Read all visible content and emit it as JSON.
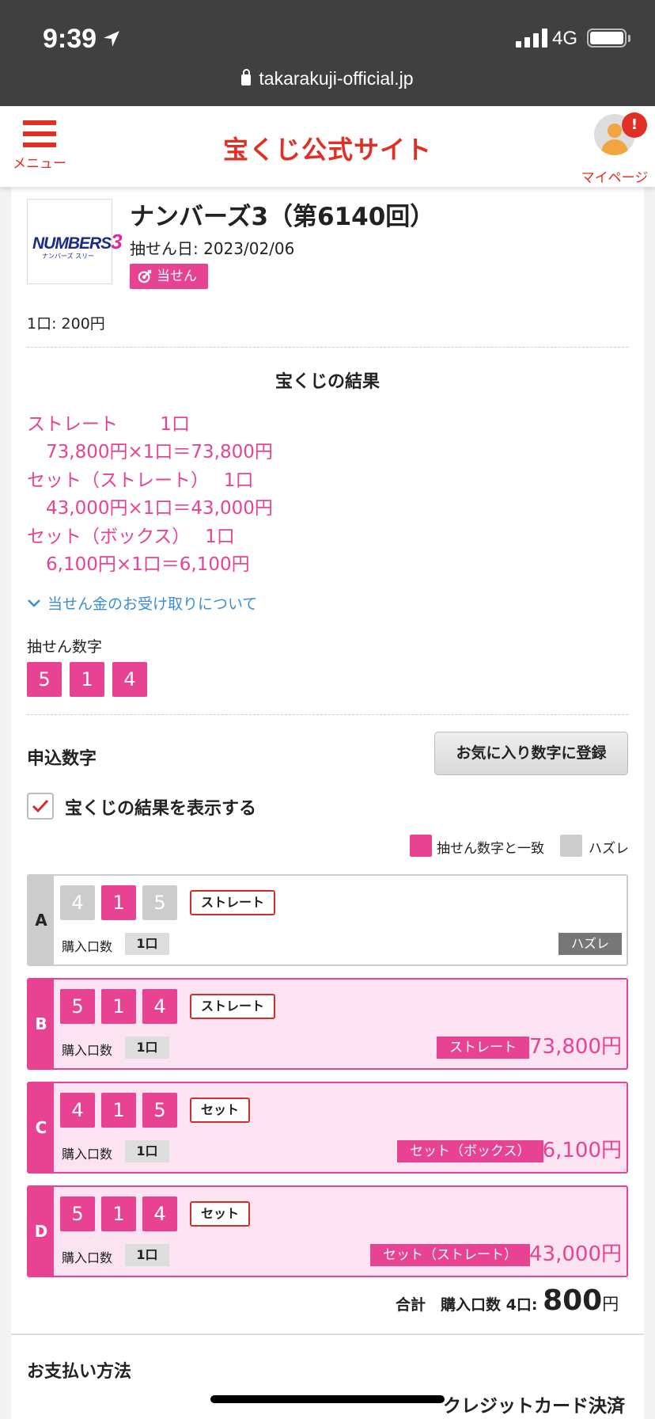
{
  "status_bar": {
    "time": "9:39",
    "network": "4G",
    "url": "takarakuji-official.jp"
  },
  "header": {
    "menu_label": "メニュー",
    "logo_text": "宝くじ公式サイト",
    "mypage_label": "マイページ",
    "alert_badge": "!"
  },
  "ticket": {
    "logo_text": "NUMBERS",
    "logo_number": "3",
    "logo_sub": "ナンバーズ スリー",
    "title": "ナンバーズ3（第6140回）",
    "draw_date": "抽せん日: 2023/02/06",
    "status_badge": "当せん",
    "unit_price": "1口: 200円"
  },
  "results": {
    "title": "宝くじの結果",
    "prizes": [
      {
        "line": "ストレート　　 1口",
        "calc": "73,800円×1口＝73,800円"
      },
      {
        "line": "セット（ストレート）　 1口",
        "calc": "43,000円×1口＝43,000円"
      },
      {
        "line": "セット（ボックス）　 1口",
        "calc": "6,100円×1口＝6,100円"
      }
    ],
    "receipt_link": "当せん金のお受け取りについて",
    "draw_numbers_label": "抽せん数字",
    "draw_numbers": [
      "5",
      "1",
      "4"
    ]
  },
  "application": {
    "label": "申込数字",
    "favorite_button": "お気に入り数字に登録",
    "show_results_label": "宝くじの結果を表示する",
    "show_results_checked": true,
    "legend_match": "抽せん数字と一致",
    "legend_miss": "ハズレ",
    "colors": {
      "match": "#e84393",
      "miss": "#cccccc"
    },
    "qty_label": "購入口数",
    "rows": [
      {
        "letter": "A",
        "numbers": [
          "4",
          "1",
          "5"
        ],
        "hits": [
          false,
          true,
          false
        ],
        "type": "ストレート",
        "qty": "1口",
        "result": "ハズレ",
        "amount": ""
      },
      {
        "letter": "B",
        "numbers": [
          "5",
          "1",
          "4"
        ],
        "hits": [
          true,
          true,
          true
        ],
        "type": "ストレート",
        "qty": "1口",
        "result": "ストレート",
        "amount": "73,800円"
      },
      {
        "letter": "C",
        "numbers": [
          "4",
          "1",
          "5"
        ],
        "hits": [
          true,
          true,
          true
        ],
        "type": "セット",
        "qty": "1口",
        "result": "セット（ボックス）",
        "amount": "6,100円"
      },
      {
        "letter": "D",
        "numbers": [
          "5",
          "1",
          "4"
        ],
        "hits": [
          true,
          true,
          true
        ],
        "type": "セット",
        "qty": "1口",
        "result": "セット（ストレート）",
        "amount": "43,000円"
      }
    ]
  },
  "total": {
    "label": "合計　購入口数 4口:",
    "amount": "800",
    "unit": "円"
  },
  "payment": {
    "label": "お支払い方法",
    "value": "クレジットカード決済"
  }
}
